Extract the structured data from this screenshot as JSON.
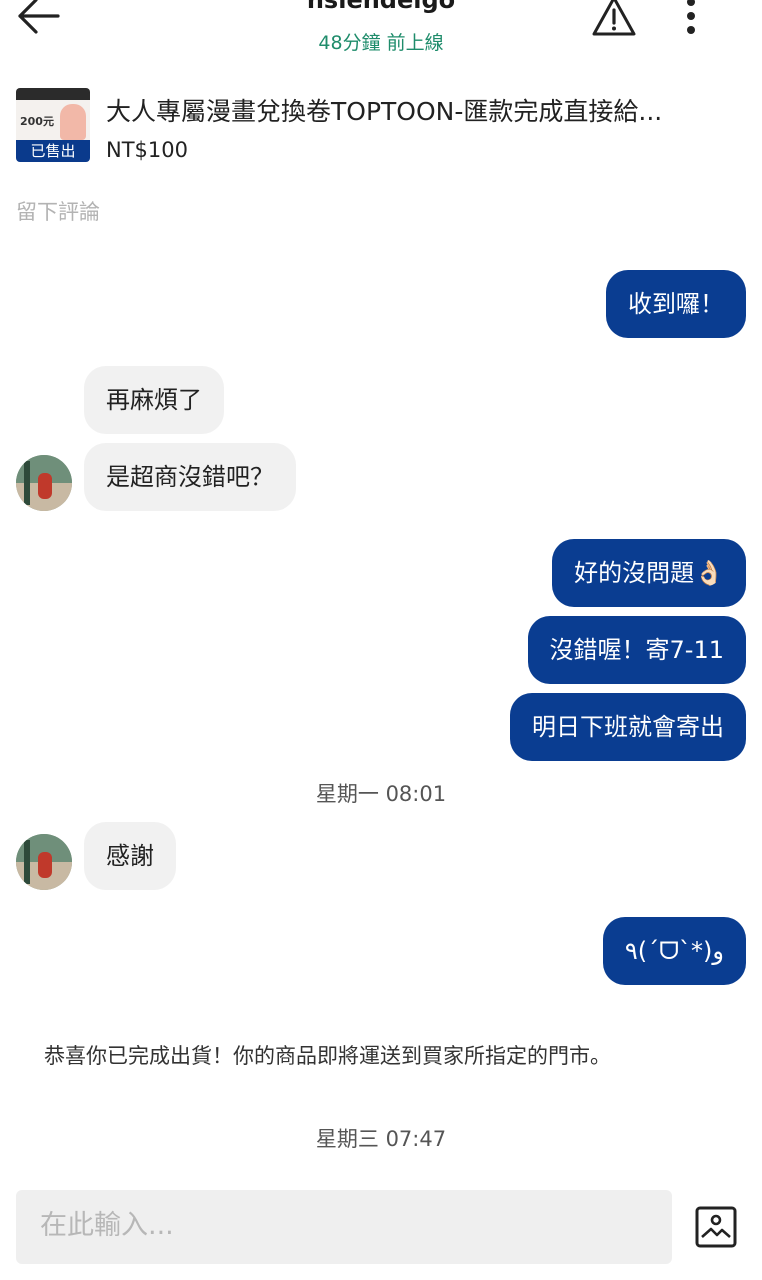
{
  "header": {
    "name": "hsiendeigo",
    "status": "48分鐘 前上線"
  },
  "product": {
    "title": "大人專屬漫畫兌換卷TOPTOON-匯款完成直接給...",
    "price": "NT$100",
    "thumb_price": "200元",
    "sold_label": "已售出"
  },
  "review_label": "留下評論",
  "messages": [
    {
      "from": "me",
      "text": "收到囉！"
    },
    {
      "from": "them",
      "text": "再麻煩了"
    },
    {
      "from": "them",
      "text": "是超商沒錯吧？"
    },
    {
      "from": "me",
      "text": "好的沒問題👌🏻"
    },
    {
      "from": "me",
      "text": "沒錯喔！寄7-11"
    },
    {
      "from": "me",
      "text": "明日下班就會寄出"
    },
    {
      "from": "them",
      "text": "感謝"
    },
    {
      "from": "me",
      "text": "٩(ˊᗜˋ*)و"
    }
  ],
  "timestamps": [
    "星期一 08:01",
    "星期三 07:47"
  ],
  "system_message": "恭喜你已完成出貨！你的商品即將運送到買家所指定的門市。",
  "composer": {
    "placeholder": "在此輸入..."
  },
  "icons": {
    "back": "arrow-left-icon",
    "report": "warning-triangle-icon",
    "more": "more-vertical-icon",
    "image": "image-upload-icon"
  },
  "colors": {
    "my_bubble": "#0a3d91",
    "their_bubble": "#f1f1f1",
    "online": "#1f8c6b"
  }
}
